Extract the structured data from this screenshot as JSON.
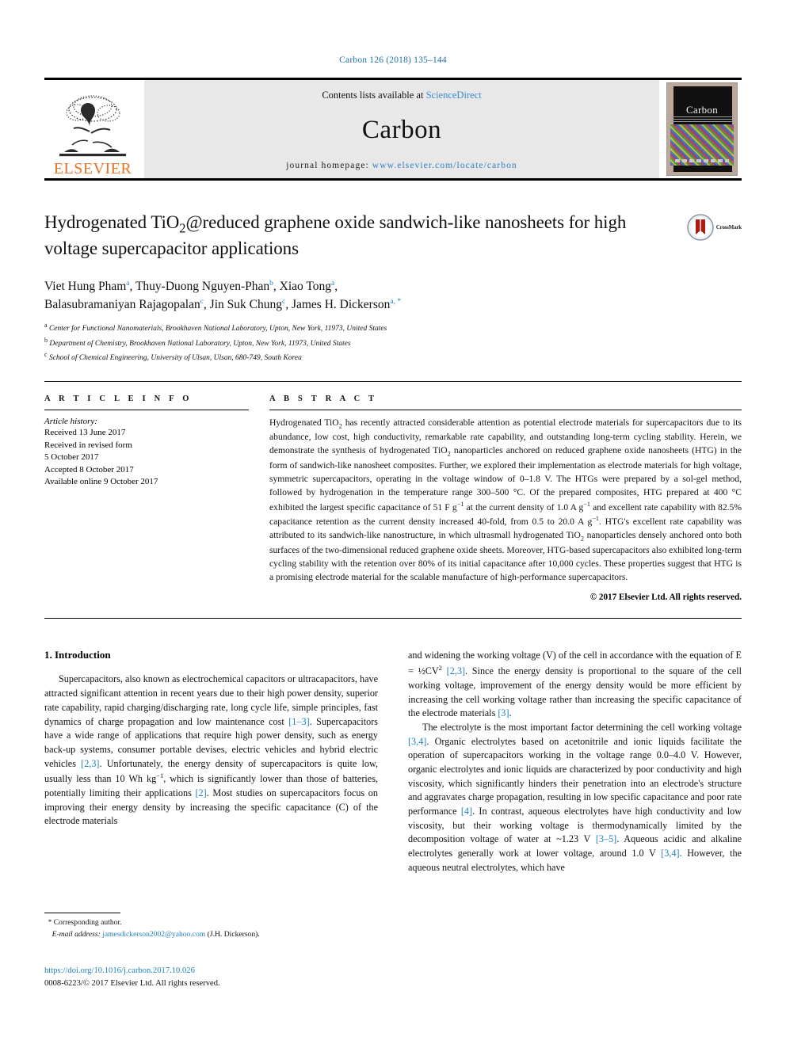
{
  "running_head": "Carbon 126 (2018) 135–144",
  "masthead": {
    "publisher_name": "ELSEVIER",
    "contents_prefix": "Contents lists available at ",
    "contents_link": "ScienceDirect",
    "journal_name": "Carbon",
    "homepage_prefix": "journal homepage: ",
    "homepage_url": "www.elsevier.com/locate/carbon",
    "cover_title": "Carbon"
  },
  "crossmark": {
    "label": "CrossMark"
  },
  "title": {
    "line1_a": "Hydrogenated TiO",
    "line1_sub": "2",
    "line1_b": "@reduced graphene oxide sandwich-like",
    "line2": "nanosheets for high voltage supercapacitor applications"
  },
  "authors": {
    "line1": [
      {
        "name": "Viet Hung Pham",
        "mark": "a",
        "sep": ", "
      },
      {
        "name": "Thuy-Duong Nguyen-Phan",
        "mark": "b",
        "sep": ", "
      },
      {
        "name": "Xiao Tong",
        "mark": "a",
        "sep": ","
      }
    ],
    "line2": [
      {
        "name": "Balasubramaniyan Rajagopalan",
        "mark": "c",
        "sep": ", "
      },
      {
        "name": "Jin Suk Chung",
        "mark": "c",
        "sep": ", "
      },
      {
        "name": "James H. Dickerson",
        "mark": "a, *",
        "sep": ""
      }
    ]
  },
  "affiliations": [
    {
      "label": "a",
      "text": "Center for Functional Nanomaterials, Brookhaven National Laboratory, Upton, New York, 11973, United States"
    },
    {
      "label": "b",
      "text": "Department of Chemistry, Brookhaven National Laboratory, Upton, New York, 11973, United States"
    },
    {
      "label": "c",
      "text": "School of Chemical Engineering, University of Ulsan, Ulsan, 680-749, South Korea"
    }
  ],
  "article_info": {
    "heading": "A R T I C L E   I N F O",
    "history_title": "Article history:",
    "history": [
      "Received 13 June 2017",
      "Received in revised form",
      "5 October 2017",
      "Accepted 8 October 2017",
      "Available online 9 October 2017"
    ]
  },
  "abstract": {
    "heading": "A B S T R A C T",
    "part1": "Hydrogenated TiO",
    "sub1": "2",
    "part2": " has recently attracted considerable attention as potential electrode materials for supercapacitors due to its abundance, low cost, high conductivity, remarkable rate capability, and outstanding long-term cycling stability. Herein, we demonstrate the synthesis of hydrogenated TiO",
    "sub2": "2",
    "part3": " nanoparticles anchored on reduced graphene oxide nanosheets (HTG) in the form of sandwich-like nanosheet composites. Further, we explored their implementation as electrode materials for high voltage, symmetric supercapacitors, operating in the voltage window of 0–1.8 V. The HTGs were prepared by a sol-gel method, followed by hydrogenation in the temperature range 300–500 °C. Of the prepared composites, HTG prepared at 400 °C exhibited the largest specific capacitance of 51 F g",
    "sup1": "−1",
    "part4": " at the current density of 1.0 A g",
    "sup2": "−1",
    "part5": " and excellent rate capability with 82.5% capacitance retention as the current density increased 40-fold, from 0.5 to 20.0 A g",
    "sup3": "−1",
    "part6": ". HTG's excellent rate capability was attributed to its sandwich-like nanostructure, in which ultrasmall hydrogenated TiO",
    "sub3": "2",
    "part7": " nanoparticles densely anchored onto both surfaces of the two-dimensional reduced graphene oxide sheets. Moreover, HTG-based supercapacitors also exhibited long-term cycling stability with the retention over 80% of its initial capacitance after 10,000 cycles. These properties suggest that HTG is a promising electrode material for the scalable manufacture of high-performance supercapacitors.",
    "copyright": "© 2017 Elsevier Ltd. All rights reserved."
  },
  "introduction": {
    "heading": "1.  Introduction",
    "left": {
      "p1_a": "Supercapacitors, also known as electrochemical capacitors or ultracapacitors, have attracted significant attention in recent years due to their high power density, superior rate capability, rapid charging/discharging rate, long cycle life, simple principles, fast dynamics of charge propagation and low maintenance cost ",
      "p1_ref1": "[1–3]",
      "p1_b": ". Supercapacitors have a wide range of applications that require high power density, such as energy back-up systems, consumer portable devises, electric vehicles and hybrid electric vehicles ",
      "p1_ref2": "[2,3]",
      "p1_c": ". Unfortunately, the energy density of supercapacitors is quite low, usually less than 10 Wh kg",
      "p1_sup": "−1",
      "p1_d": ", which is significantly lower than those of batteries, potentially limiting their applications ",
      "p1_ref3": "[2]",
      "p1_e": ". Most studies on supercapacitors focus on improving their energy density by increasing the specific capacitance (C) of the electrode materials"
    },
    "right": {
      "p1_a": "and widening the working voltage (V) of the cell in accordance with the equation of E = ½CV",
      "p1_sup": "2",
      "p1_b": " ",
      "p1_ref1": "[2,3]",
      "p1_c": ". Since the energy density is proportional to the square of the cell working voltage, improvement of the energy density would be more efficient by increasing the cell working voltage rather than increasing the specific capacitance of the electrode materials ",
      "p1_ref2": "[3]",
      "p1_d": ".",
      "p2_a": "The electrolyte is the most important factor determining the cell working voltage ",
      "p2_ref1": "[3,4]",
      "p2_b": ". Organic electrolytes based on acetonitrile and ionic liquids facilitate the operation of supercapacitors working in the voltage range 0.0–4.0 V. However, organic electrolytes and ionic liquids are characterized by poor conductivity and high viscosity, which significantly hinders their penetration into an electrode's structure and aggravates charge propagation, resulting in low specific capacitance and poor rate performance ",
      "p2_ref2": "[4]",
      "p2_c": ". In contrast, aqueous electrolytes have high conductivity and low viscosity, but their working voltage is thermodynamically limited by the decomposition voltage of water at ~1.23 V ",
      "p2_ref3": "[3–5]",
      "p2_d": ". Aqueous acidic and alkaline electrolytes generally work at lower voltage, around 1.0 V ",
      "p2_ref4": "[3,4]",
      "p2_e": ". However, the aqueous neutral electrolytes, which have"
    }
  },
  "footnote": {
    "star": "*",
    "corresponding": "Corresponding author.",
    "email_label": "E-mail address:",
    "email": "jamesdickerson2002@yahoo.com",
    "email_owner": "(J.H. Dickerson)."
  },
  "footer": {
    "doi": "https://doi.org/10.1016/j.carbon.2017.10.026",
    "issn": "0008-6223/© 2017 Elsevier Ltd. All rights reserved."
  },
  "colors": {
    "link": "#1f7fbf",
    "elsevier_orange": "#e87324",
    "sciencedirect": "#3b8bd0",
    "masthead_bg": "#e8e8e8"
  }
}
